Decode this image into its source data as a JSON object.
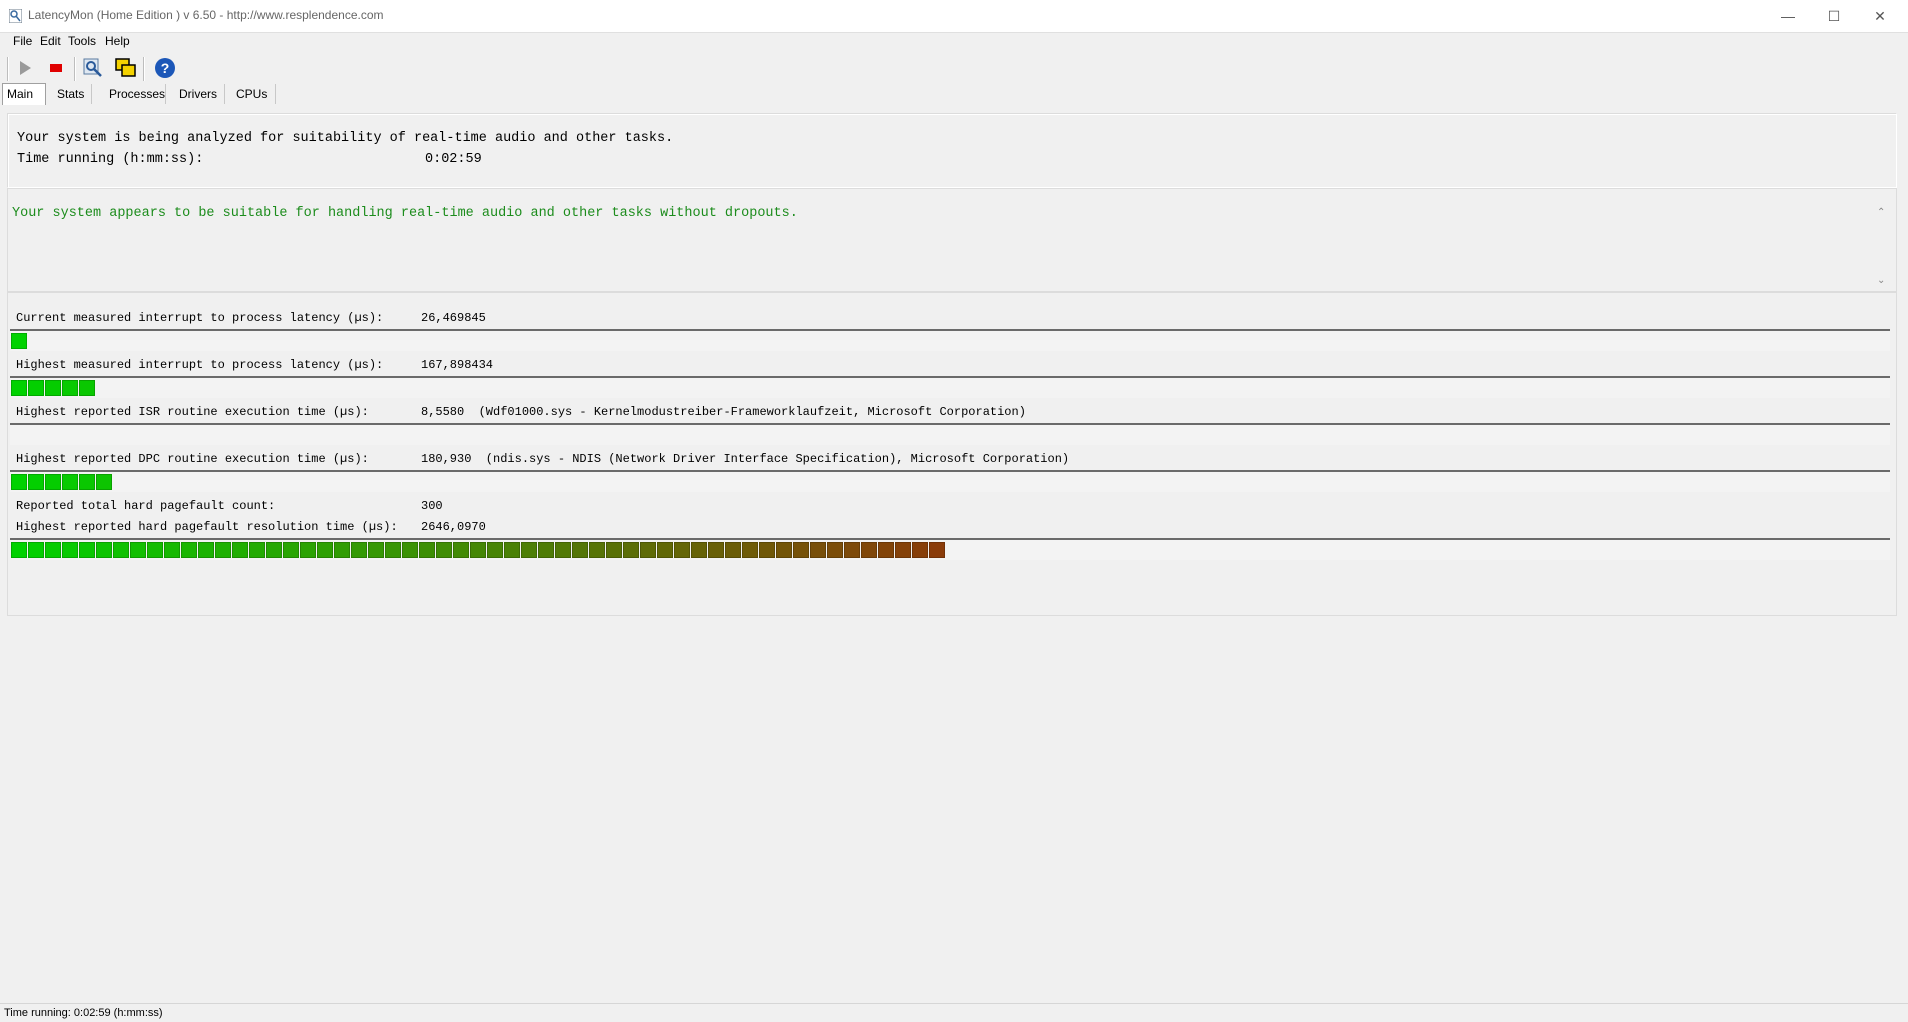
{
  "window": {
    "title": "LatencyMon  (Home Edition )  v 6.50 - http://www.resplendence.com",
    "minimize_icon": "minimize-icon",
    "maximize_icon": "maximize-icon",
    "close_icon": "close-icon"
  },
  "menu": [
    "File",
    "Edit",
    "Tools",
    "Help"
  ],
  "toolbar": {
    "icons": [
      "start-icon",
      "stop-icon",
      "analyze-icon",
      "windows-icon",
      "help-icon"
    ],
    "colors": {
      "stop": "#e00000",
      "help": "#1c57b8"
    }
  },
  "tabs": [
    "Main",
    "Stats",
    "Processes",
    "Drivers",
    "CPUs"
  ],
  "main": {
    "analyzing_text": "Your system is being analyzed for suitability of real-time audio and other tasks.",
    "time_running_label": "Time running (h:mm:ss):",
    "time_running_value": "0:02:59",
    "verdict": "Your system appears to be suitable for handling real-time audio and other tasks without dropouts.",
    "verdict_color": "#1c8c1c",
    "metrics": [
      {
        "label": "Current measured interrupt to process latency (µs):",
        "value": "26,469845",
        "bar_cells": 1
      },
      {
        "label": "Highest measured interrupt to process latency (µs):",
        "value": "167,898434",
        "bar_cells": 5
      },
      {
        "label": "Highest reported ISR routine execution time (µs):",
        "value": "8,5580  (Wdf01000.sys - Kernelmodustreiber-Frameworklaufzeit, Microsoft Corporation)",
        "bar_cells": 0
      },
      {
        "label": "Highest reported DPC routine execution time (µs):",
        "value": "180,930  (ndis.sys - NDIS (Network Driver Interface Specification), Microsoft Corporation)",
        "bar_cells": 6
      },
      {
        "label": "Reported total hard pagefault count:",
        "value": "300"
      },
      {
        "label": "Highest reported hard pagefault resolution time (µs):",
        "value": "2646,0970",
        "bar_cells": 55
      }
    ]
  },
  "status_bar": "Time running: 0:02:59  (h:mm:ss)"
}
